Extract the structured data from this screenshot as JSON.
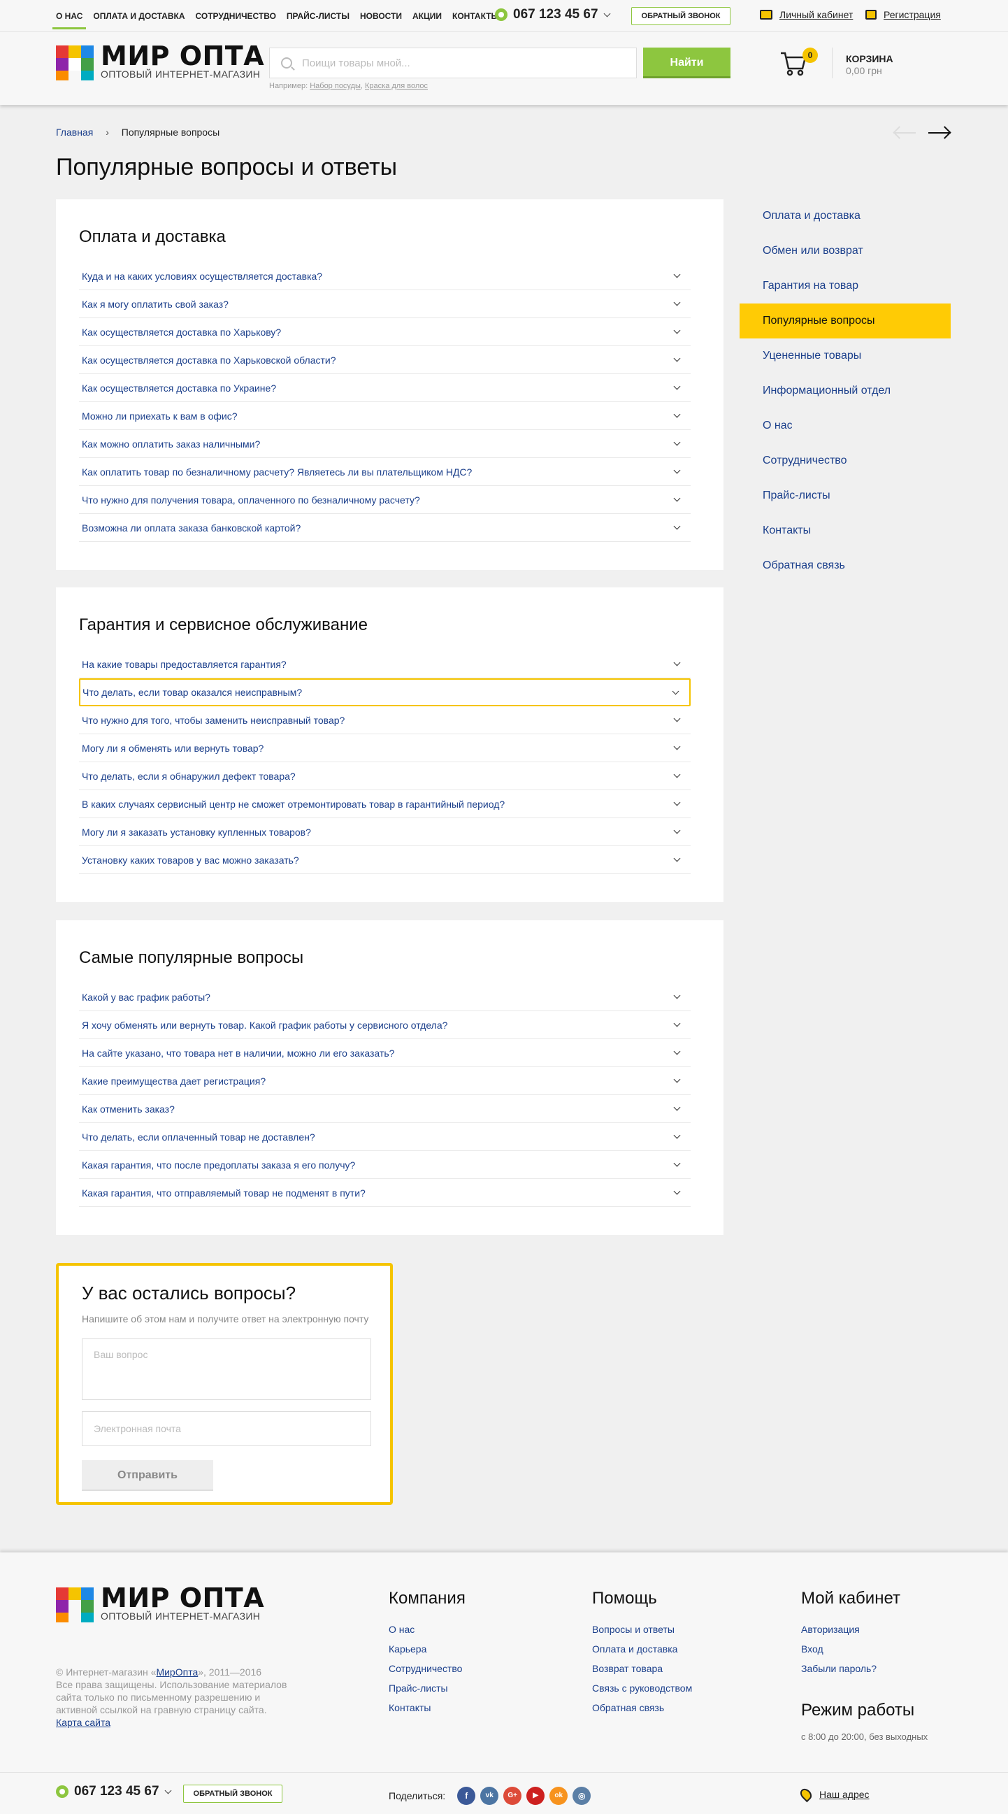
{
  "topnav": {
    "items": [
      "О НАС",
      "ОПЛАТА И ДОСТАВКА",
      "СОТРУДНИЧЕСТВО",
      "ПРАЙС-ЛИСТЫ",
      "НОВОСТИ",
      "АКЦИИ",
      "КОНТАКТЫ"
    ],
    "phone": "067 123 45 67",
    "callback": "ОБРАТНЫЙ ЗВОНОК",
    "account": "Личный кабинет",
    "register": "Регистрация"
  },
  "brand": {
    "name": "МИР ОПТА",
    "tagline": "ОПТОВЫЙ ИНТЕРНЕТ-МАГАЗИН"
  },
  "search": {
    "placeholder": "Поищи товары мной...",
    "button": "Найти",
    "hint_prefix": "Например:",
    "hint_links": [
      "Набор посуды",
      "Краска для волос"
    ]
  },
  "cart": {
    "count": "0",
    "label": "КОРЗИНА",
    "total": "0,00 грн"
  },
  "breadcrumb": {
    "home": "Главная",
    "current": "Популярные вопросы"
  },
  "page_title": "Популярные вопросы и ответы",
  "sections": [
    {
      "title": "Оплата и доставка",
      "questions": [
        "Куда и на каких условиях осуществляется доставка?",
        "Как я могу оплатить свой заказ?",
        "Как осуществляется доставка по Харькову?",
        "Как осуществляется доставка по Харьковской области?",
        "Как осуществляется доставка по Украине?",
        "Можно ли приехать к вам в офис?",
        "Как можно оплатить заказ наличными?",
        "Как оплатить товар по безналичному расчету? Являетесь ли вы плательщиком НДС?",
        "Что нужно для получения товара, оплаченного по безналичному расчету?",
        "Возможна ли оплата заказа банковской картой?"
      ]
    },
    {
      "title": "Гарантия и сервисное обслуживание",
      "questions": [
        "На какие товары предоставляется гарантия?",
        "Что делать, если товар оказался неисправным?",
        "Что нужно для того, чтобы заменить неисправный товар?",
        "Могу ли я обменять или вернуть товар?",
        "Что делать, если я обнаружил дефект товара?",
        "В каких случаях сервисный центр не сможет отремонтировать товар в гарантийный период?",
        "Могу ли я заказать установку купленных товаров?",
        "Установку каких товаров у вас можно заказать?"
      ]
    },
    {
      "title": "Самые популярные вопросы",
      "questions": [
        "Какой у вас график работы?",
        "Я хочу обменять или вернуть товар. Какой график работы у сервисного отдела?",
        "На сайте указано, что товара нет в наличии, можно ли его заказать?",
        "Какие преимущества дает регистрация?",
        "Как отменить заказ?",
        "Что делать, если оплаченный товар не доставлен?",
        "Какая гарантия, что после предоплаты заказа я его получу?",
        "Какая гарантия, что отправляемый товар не подменят в пути?"
      ]
    }
  ],
  "side_menu": [
    "Оплата и доставка",
    "Обмен или возврат",
    "Гарантия на товар",
    "Популярные вопросы",
    "Уцененные товары",
    "Информационный отдел",
    "О нас",
    "Сотрудничество",
    "Прайс-листы",
    "Контакты",
    "Обратная связь"
  ],
  "ask": {
    "title": "У вас остались вопросы?",
    "subtitle": "Напишите об этом нам и получите ответ на электронную почту",
    "question_placeholder": "Ваш вопрос",
    "email_placeholder": "Электронная почта",
    "send": "Отправить"
  },
  "footer": {
    "copy_prefix": "© Интернет-магазин «",
    "copy_link": "МирОпта",
    "copy_suffix": "», 2011—2016",
    "rights": "Все права защищены. Использование материалов сайта только по письменному разрешению и активной ссылкой на гравную страницу сайта.",
    "sitemap": "Карта сайта",
    "company": {
      "title": "Компания",
      "links": [
        "О нас",
        "Карьера",
        "Сотрудничество",
        "Прайс-листы",
        "Контакты"
      ]
    },
    "help": {
      "title": "Помощь",
      "links": [
        "Вопросы и ответы",
        "Оплата и доставка",
        "Возврат товара",
        "Связь с руководством",
        "Обратная связь"
      ]
    },
    "cabinet": {
      "title": "Мой кабинет",
      "links": [
        "Авторизация",
        "Вход",
        "Забыли пароль?"
      ]
    },
    "hours": {
      "title": "Режим работы",
      "text": "с 8:00 до 20:00, без выходных"
    },
    "phone": "067 123 45 67",
    "callback": "ОБРАТНЫЙ ЗВОНОК",
    "share": "Поделиться:",
    "social": [
      {
        "name": "facebook-icon",
        "glyph": "f",
        "color": "#3b5998"
      },
      {
        "name": "vk-icon",
        "glyph": "vk",
        "color": "#4c75a3"
      },
      {
        "name": "google-plus-icon",
        "glyph": "G+",
        "color": "#dd4b39"
      },
      {
        "name": "youtube-icon",
        "glyph": "▶",
        "color": "#cd201f"
      },
      {
        "name": "odnoklassniki-icon",
        "glyph": "ok",
        "color": "#f7931e"
      },
      {
        "name": "instagram-icon",
        "glyph": "◎",
        "color": "#5b7fa6"
      }
    ],
    "address": "Наш адрес"
  },
  "colors": {
    "accent_green": "#8dc63f",
    "accent_yellow": "#ffcb05",
    "link": "#1b3f8b"
  }
}
